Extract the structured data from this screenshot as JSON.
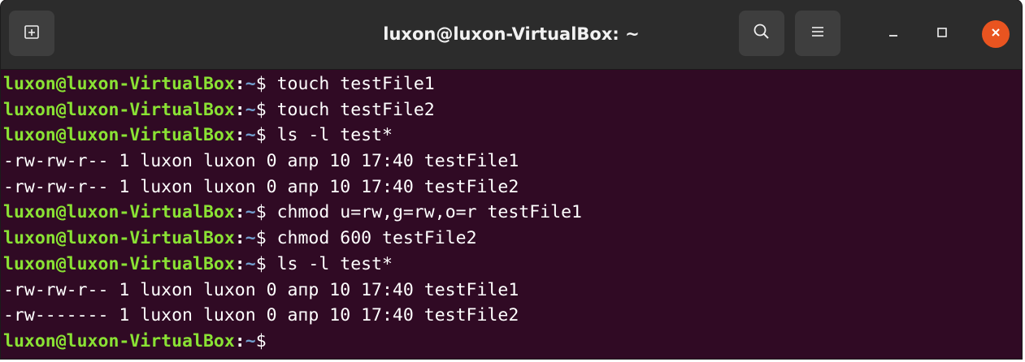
{
  "window": {
    "title": "luxon@luxon-VirtualBox: ~"
  },
  "titlebar": {
    "icons": {
      "new_tab": "new-tab-icon",
      "search": "search-icon",
      "menu": "hamburger-menu-icon",
      "minimize": "minimize-icon",
      "maximize": "maximize-icon",
      "close": "close-icon"
    },
    "close_color": "#e95420"
  },
  "terminal": {
    "colors": {
      "background": "#300a24",
      "user": "#8ae234",
      "path": "#729fcf",
      "text": "#ffffff"
    },
    "prompt": {
      "user_host": "luxon@luxon-VirtualBox",
      "colon": ":",
      "path": "~",
      "symbol": "$"
    },
    "lines": [
      {
        "type": "command",
        "text": " touch testFile1"
      },
      {
        "type": "command",
        "text": " touch testFile2"
      },
      {
        "type": "command",
        "text": " ls -l test*"
      },
      {
        "type": "output",
        "text": "-rw-rw-r-- 1 luxon luxon 0 апр 10 17:40 testFile1"
      },
      {
        "type": "output",
        "text": "-rw-rw-r-- 1 luxon luxon 0 апр 10 17:40 testFile2"
      },
      {
        "type": "command",
        "text": " chmod u=rw,g=rw,o=r testFile1"
      },
      {
        "type": "command",
        "text": " chmod 600 testFile2"
      },
      {
        "type": "command",
        "text": " ls -l test*"
      },
      {
        "type": "output",
        "text": "-rw-rw-r-- 1 luxon luxon 0 апр 10 17:40 testFile1"
      },
      {
        "type": "output",
        "text": "-rw------- 1 luxon luxon 0 апр 10 17:40 testFile2"
      },
      {
        "type": "command",
        "text": ""
      }
    ]
  }
}
